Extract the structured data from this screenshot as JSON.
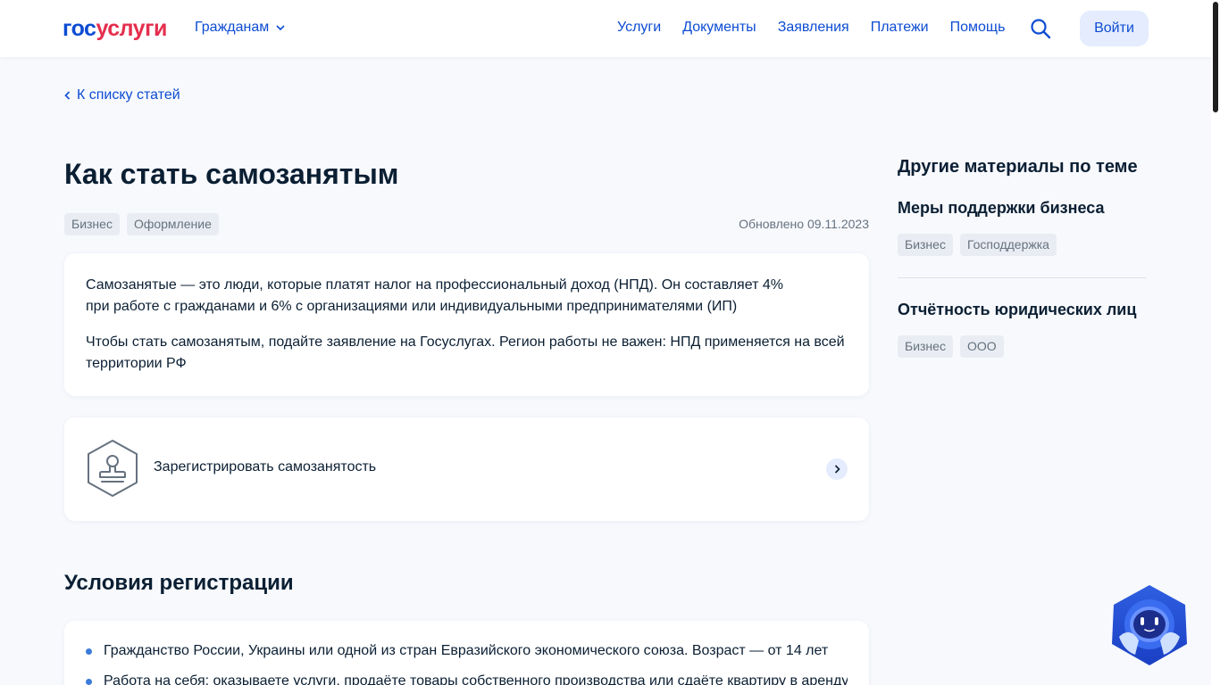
{
  "header": {
    "logo_part1": "гос",
    "logo_part2": "услуги",
    "audience": "Гражданам",
    "nav": [
      "Услуги",
      "Документы",
      "Заявления",
      "Платежи",
      "Помощь"
    ],
    "login_label": "Войти"
  },
  "back_link": "К списку статей",
  "article": {
    "title": "Как стать самозанятым",
    "tags": [
      "Бизнес",
      "Оформление"
    ],
    "updated": "Обновлено 09.11.2023",
    "intro_p1_line1": "Самозанятые — это люди, которые платят налог на профессиональный доход (НПД). Он составляет 4%",
    "intro_p1_line2": "при работе с гражданами и 6% с организациями или индивидуальными предпринимателями (ИП)",
    "intro_p2": "Чтобы стать самозанятым, подайте заявление на Госуслугах. Регион работы не важен: НПД применяется на всей территории РФ",
    "action_label": "Зарегистрировать самозанятость",
    "conditions_title": "Условия регистрации",
    "conditions": [
      "Гражданство России, Украины или одной из стран Евразийского экономического союза. Возраст — от 14 лет",
      "Работа на себя: оказываете услуги, продаёте товары собственного производства или сдаёте квартиру в аренду"
    ]
  },
  "sidebar": {
    "title": "Другие материалы по теме",
    "items": [
      {
        "title": "Меры поддержки бизнеса",
        "tags": [
          "Бизнес",
          "Господдержка"
        ]
      },
      {
        "title": "Отчётность юридических лиц",
        "tags": [
          "Бизнес",
          "ООО"
        ]
      }
    ]
  },
  "colors": {
    "brand_blue": "#0d4cd3",
    "brand_red": "#e52e4d",
    "text": "#0b1f33",
    "muted": "#66727f"
  }
}
